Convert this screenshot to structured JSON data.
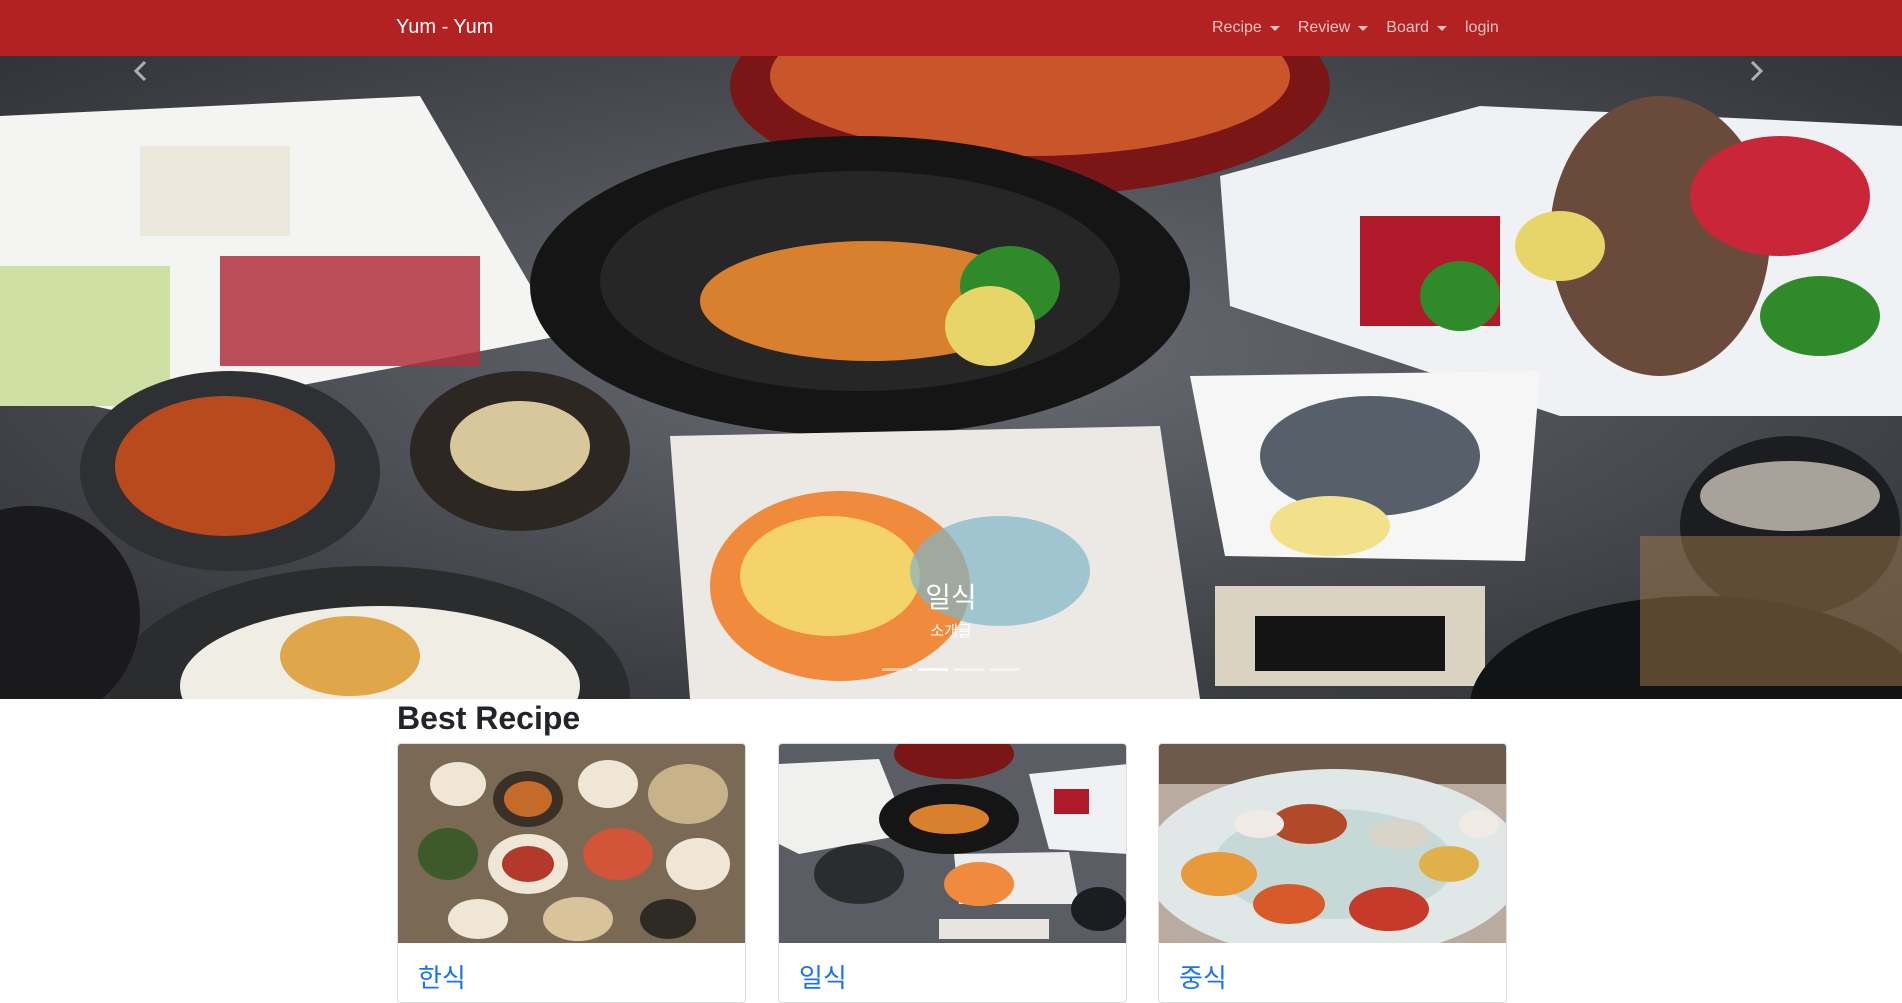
{
  "navbar": {
    "brand": "Yum - Yum",
    "items": [
      {
        "label": "Recipe",
        "dropdown": true
      },
      {
        "label": "Review",
        "dropdown": true
      },
      {
        "label": "Board",
        "dropdown": true
      },
      {
        "label": "login",
        "dropdown": false
      }
    ]
  },
  "carousel": {
    "title": "일식",
    "text": "소개글",
    "slide_count": 4,
    "active_slide": 2,
    "prev_icon": "chevron-left-icon",
    "next_icon": "chevron-right-icon"
  },
  "best": {
    "heading": "Best Recipe",
    "cards": [
      {
        "title": "한식"
      },
      {
        "title": "일식"
      },
      {
        "title": "중식"
      }
    ]
  },
  "colors": {
    "navbar_bg": "#b22222",
    "link": "#1a73e8",
    "heading": "#212529"
  }
}
